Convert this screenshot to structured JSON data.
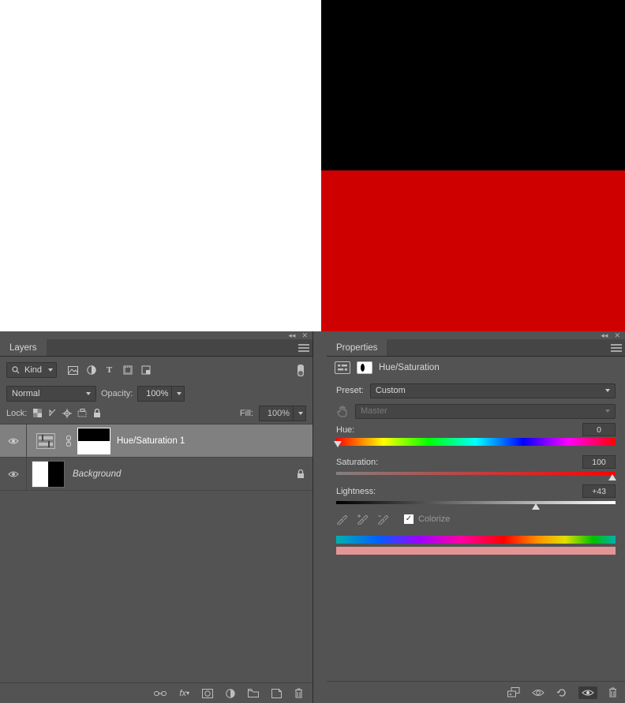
{
  "layers_panel": {
    "title": "Layers",
    "filter_kind_label": "Kind",
    "blend_mode": "Normal",
    "opacity_label": "Opacity:",
    "opacity_value": "100%",
    "lock_label": "Lock:",
    "fill_label": "Fill:",
    "fill_value": "100%",
    "items": [
      {
        "name": "Hue/Saturation 1"
      },
      {
        "name": "Background"
      }
    ]
  },
  "properties_panel": {
    "title": "Properties",
    "adjustment_title": "Hue/Saturation",
    "preset_label": "Preset:",
    "preset_value": "Custom",
    "channel_value": "Master",
    "hue_label": "Hue:",
    "hue_value": "0",
    "saturation_label": "Saturation:",
    "saturation_value": "100",
    "lightness_label": "Lightness:",
    "lightness_value": "+43",
    "colorize_label": "Colorize",
    "colorize_checked": true
  }
}
